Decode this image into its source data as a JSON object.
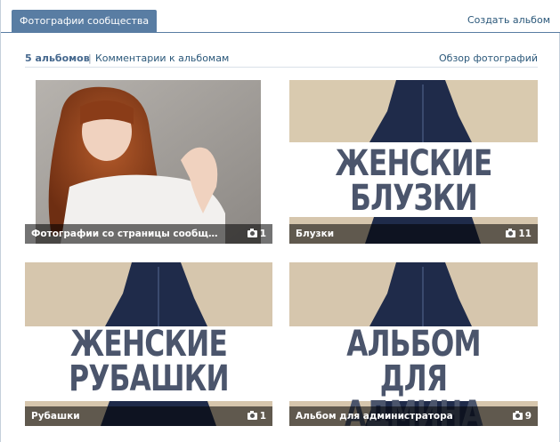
{
  "tabs": {
    "active": "Фотографии сообщества",
    "create_album": "Создать альбом"
  },
  "summary": {
    "albums_count": "5 альбомов",
    "separator": "|",
    "comments_link": "Комментарии к альбомам",
    "overview_link": "Обзор фотографий"
  },
  "albums": [
    {
      "title": "Фотографии со страницы сообще...",
      "count": "1",
      "icon": "camera-icon"
    },
    {
      "title": "Блузки",
      "count": "11",
      "banner_line1": "ЖЕНСКИЕ",
      "banner_line2": "БЛУЗКИ",
      "icon": "camera-icon"
    },
    {
      "title": "Рубашки",
      "count": "1",
      "banner_line1": "ЖЕНСКИЕ",
      "banner_line2": "РУБАШКИ",
      "icon": "camera-icon"
    },
    {
      "title": "Альбом для администратора",
      "count": "9",
      "banner_line1": "АЛЬБОМ",
      "banner_line2": "ДЛЯ АДМИНА",
      "icon": "camera-icon"
    }
  ],
  "colors": {
    "accent": "#597da3",
    "link": "#2b587a",
    "banner_text": "#4b556c",
    "beige": "#d9c9b0",
    "blouse_navy": "#1f2b4a"
  }
}
